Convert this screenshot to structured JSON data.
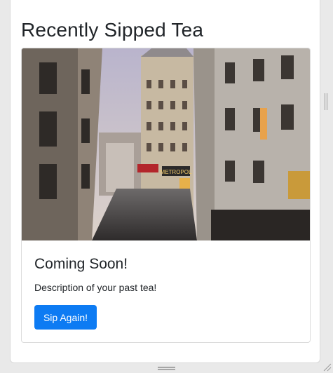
{
  "section": {
    "title": "Recently Sipped Tea"
  },
  "card": {
    "image_alt": "Street view of Paris",
    "image_sign": "METROPOL",
    "title": "Coming Soon!",
    "text": "Description of your past tea!",
    "button_label": "Sip Again!"
  },
  "colors": {
    "button": "#0d7bf3",
    "heading": "#212529"
  }
}
